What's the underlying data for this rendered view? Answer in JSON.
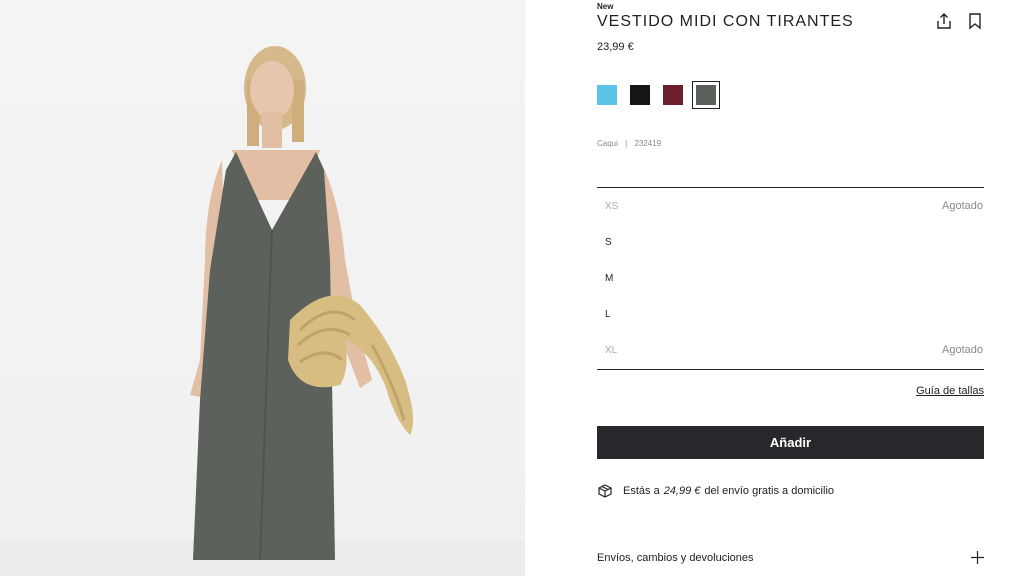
{
  "product": {
    "badge": "New",
    "title": "VESTIDO MIDI CON TIRANTES",
    "price": "23,99 €",
    "color_name": "Caqui",
    "ref_separator": "|",
    "ref": "232419",
    "image_alt": "product-photo"
  },
  "actions": {
    "share_icon": "share-icon",
    "save_icon": "bookmark-icon"
  },
  "colors": [
    {
      "name": "light-blue",
      "hex": "#5bc4e8",
      "selected": false
    },
    {
      "name": "black",
      "hex": "#151515",
      "selected": false
    },
    {
      "name": "burgundy",
      "hex": "#6b1f2d",
      "selected": false
    },
    {
      "name": "khaki",
      "hex": "#5b5f5a",
      "selected": true
    }
  ],
  "sizes": [
    {
      "label": "XS",
      "status": "Agotado"
    },
    {
      "label": "S",
      "status": ""
    },
    {
      "label": "M",
      "status": ""
    },
    {
      "label": "L",
      "status": ""
    },
    {
      "label": "XL",
      "status": "Agotado"
    }
  ],
  "size_guide": "Guía de tallas",
  "add_button": "Añadir",
  "shipping": {
    "prefix": "Estás a",
    "amount": "24,99 €",
    "suffix": "del envío gratis a domicilio"
  },
  "accordion": {
    "label": "Envíos, cambios y devoluciones",
    "icon": "plus-icon"
  }
}
